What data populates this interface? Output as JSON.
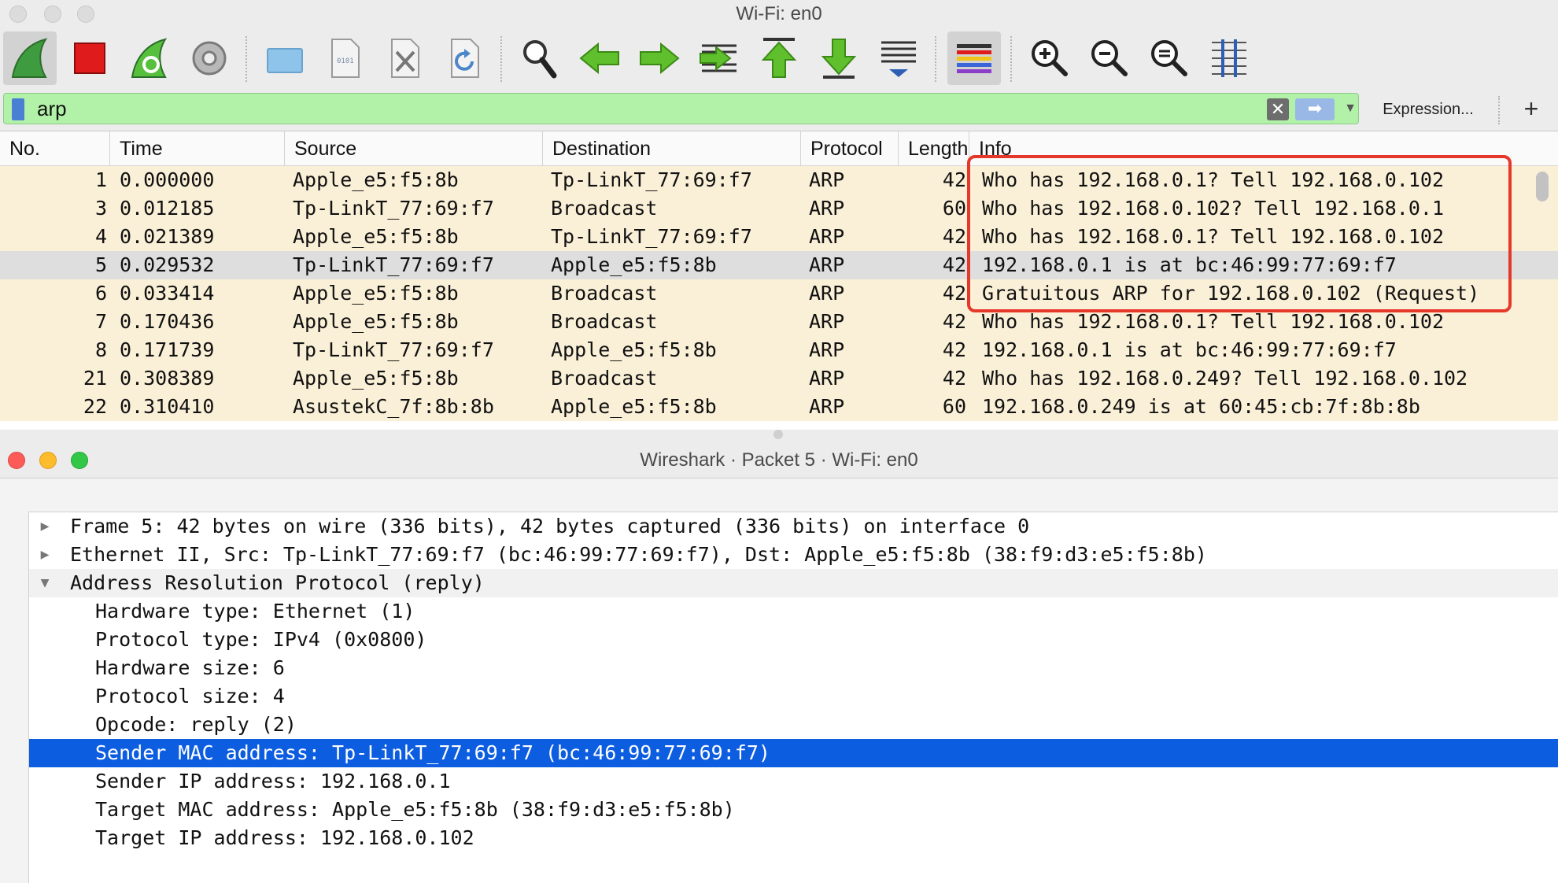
{
  "main_window": {
    "title": "Wi-Fi: en0",
    "filter": {
      "value": "arp",
      "expression_label": "Expression...",
      "add_label": "+"
    },
    "columns": [
      "No.",
      "Time",
      "Source",
      "Destination",
      "Protocol",
      "Length",
      "Info"
    ],
    "packets": [
      {
        "no": "1",
        "time": "0.000000",
        "source": "Apple_e5:f5:8b",
        "destination": "Tp-LinkT_77:69:f7",
        "protocol": "ARP",
        "length": "42",
        "info": "Who has 192.168.0.1? Tell 192.168.0.102"
      },
      {
        "no": "3",
        "time": "0.012185",
        "source": "Tp-LinkT_77:69:f7",
        "destination": "Broadcast",
        "protocol": "ARP",
        "length": "60",
        "info": "Who has 192.168.0.102? Tell 192.168.0.1"
      },
      {
        "no": "4",
        "time": "0.021389",
        "source": "Apple_e5:f5:8b",
        "destination": "Tp-LinkT_77:69:f7",
        "protocol": "ARP",
        "length": "42",
        "info": "Who has 192.168.0.1? Tell 192.168.0.102"
      },
      {
        "no": "5",
        "time": "0.029532",
        "source": "Tp-LinkT_77:69:f7",
        "destination": "Apple_e5:f5:8b",
        "protocol": "ARP",
        "length": "42",
        "info": "192.168.0.1 is at bc:46:99:77:69:f7"
      },
      {
        "no": "6",
        "time": "0.033414",
        "source": "Apple_e5:f5:8b",
        "destination": "Broadcast",
        "protocol": "ARP",
        "length": "42",
        "info": "Gratuitous ARP for 192.168.0.102 (Request)"
      },
      {
        "no": "7",
        "time": "0.170436",
        "source": "Apple_e5:f5:8b",
        "destination": "Broadcast",
        "protocol": "ARP",
        "length": "42",
        "info": "Who has 192.168.0.1? Tell 192.168.0.102"
      },
      {
        "no": "8",
        "time": "0.171739",
        "source": "Tp-LinkT_77:69:f7",
        "destination": "Apple_e5:f5:8b",
        "protocol": "ARP",
        "length": "42",
        "info": "192.168.0.1 is at bc:46:99:77:69:f7"
      },
      {
        "no": "21",
        "time": "0.308389",
        "source": "Apple_e5:f5:8b",
        "destination": "Broadcast",
        "protocol": "ARP",
        "length": "42",
        "info": "Who has 192.168.0.249? Tell 192.168.0.102"
      },
      {
        "no": "22",
        "time": "0.310410",
        "source": "AsustekC_7f:8b:8b",
        "destination": "Apple_e5:f5:8b",
        "protocol": "ARP",
        "length": "60",
        "info": "192.168.0.249 is at 60:45:cb:7f:8b:8b"
      }
    ],
    "selected_packet_no": "5"
  },
  "detail_window": {
    "title": "Wireshark · Packet 5 · Wi-Fi: en0",
    "tree": [
      {
        "text": "Frame 5: 42 bytes on wire (336 bits), 42 bytes captured (336 bits) on interface 0",
        "expander": "▶"
      },
      {
        "text": "Ethernet II, Src: Tp-LinkT_77:69:f7 (bc:46:99:77:69:f7), Dst: Apple_e5:f5:8b (38:f9:d3:e5:f5:8b)",
        "expander": "▶"
      },
      {
        "text": "Address Resolution Protocol (reply)",
        "expander": "▼"
      },
      {
        "text": "Hardware type: Ethernet (1)"
      },
      {
        "text": "Protocol type: IPv4 (0x0800)"
      },
      {
        "text": "Hardware size: 6"
      },
      {
        "text": "Protocol size: 4"
      },
      {
        "text": "Opcode: reply (2)"
      },
      {
        "text": "Sender MAC address: Tp-LinkT_77:69:f7 (bc:46:99:77:69:f7)"
      },
      {
        "text": "Sender IP address: 192.168.0.1"
      },
      {
        "text": "Target MAC address: Apple_e5:f5:8b (38:f9:d3:e5:f5:8b)"
      },
      {
        "text": "Target IP address: 192.168.0.102"
      }
    ]
  },
  "colors": {
    "row_bg": "#faf0d7",
    "selected_row_bg": "#dedede",
    "filter_bg": "#b2f2a8",
    "highlight_box": "#e5382a",
    "detail_selection": "#0c5de0"
  },
  "icons": {
    "toolbar": [
      "shark-fin-start-icon",
      "stop-capture-icon",
      "restart-capture-icon",
      "capture-options-gear-icon",
      "open-folder-icon",
      "save-file-icon",
      "close-file-icon",
      "reload-file-icon",
      "find-packet-icon",
      "go-back-icon",
      "go-forward-icon",
      "go-to-packet-icon",
      "first-packet-icon",
      "last-packet-icon",
      "auto-scroll-icon",
      "colorize-icon",
      "zoom-in-icon",
      "zoom-out-icon",
      "normal-size-icon",
      "resize-columns-icon"
    ]
  }
}
